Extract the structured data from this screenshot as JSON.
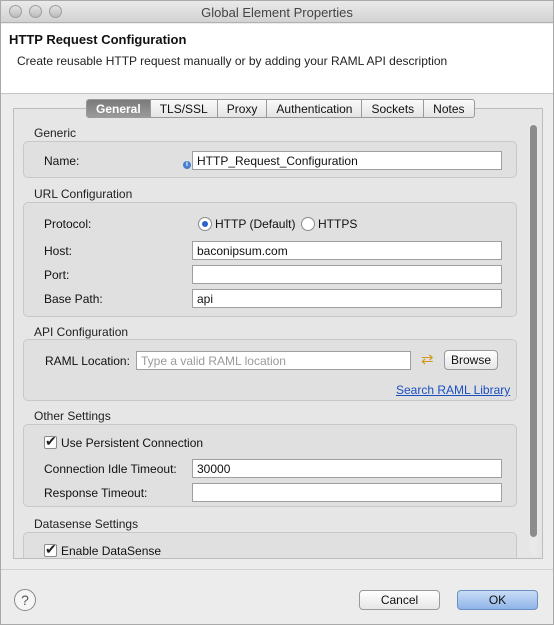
{
  "window": {
    "title": "Global Element Properties"
  },
  "header": {
    "title": "HTTP Request Configuration",
    "description": "Create reusable HTTP request manually or by adding your RAML API description"
  },
  "tabs": [
    {
      "label": "General",
      "active": true
    },
    {
      "label": "TLS/SSL"
    },
    {
      "label": "Proxy"
    },
    {
      "label": "Authentication"
    },
    {
      "label": "Sockets"
    },
    {
      "label": "Notes"
    }
  ],
  "generic": {
    "title": "Generic",
    "name_label": "Name:",
    "name_value": "HTTP_Request_Configuration"
  },
  "url_config": {
    "title": "URL Configuration",
    "protocol_label": "Protocol:",
    "protocol_options": [
      "HTTP (Default)",
      "HTTPS"
    ],
    "protocol_selected": "HTTP (Default)",
    "host_label": "Host:",
    "host_value": "baconipsum.com",
    "port_label": "Port:",
    "port_value": "",
    "base_path_label": "Base Path:",
    "base_path_value": "api"
  },
  "api_config": {
    "title": "API Configuration",
    "raml_label": "RAML Location:",
    "raml_placeholder": "Type a valid RAML location",
    "browse_label": "Browse",
    "search_link": "Search RAML Library"
  },
  "other_settings": {
    "title": "Other Settings",
    "persistent_label": "Use Persistent Connection",
    "persistent_checked": true,
    "idle_timeout_label": "Connection Idle Timeout:",
    "idle_timeout_value": "30000",
    "response_timeout_label": "Response Timeout:",
    "response_timeout_value": ""
  },
  "datasense": {
    "title": "Datasense Settings",
    "enable_label": "Enable DataSense",
    "enable_checked": true
  },
  "footer": {
    "help_symbol": "?",
    "cancel_label": "Cancel",
    "ok_label": "OK"
  },
  "colors": {
    "link": "#1a4fc1",
    "primary_button": "#8fb5e8",
    "radio_accent": "#2a64c8"
  }
}
